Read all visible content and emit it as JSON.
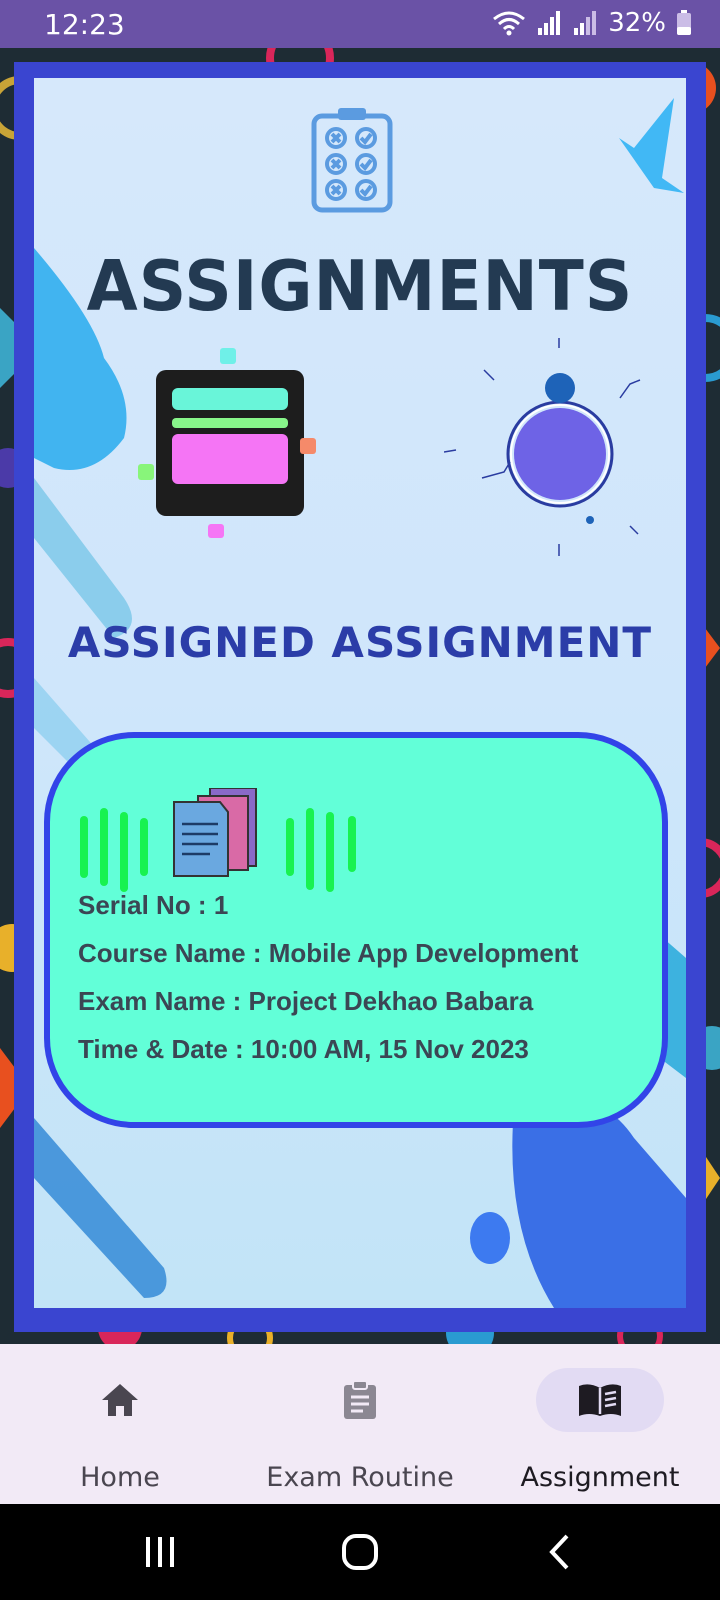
{
  "status_bar": {
    "time": "12:23",
    "battery": "32%"
  },
  "page": {
    "title": "ASSIGNMENTS",
    "section_title": "ASSIGNED ASSIGNMENT"
  },
  "assignment_card": {
    "serial": "Serial No : 1",
    "course": "Course Name : Mobile App Development",
    "exam": "Exam Name : Project Dekhao Babara",
    "datetime": "Time & Date  : 10:00 AM, 15 Nov 2023"
  },
  "bottom_nav": {
    "items": [
      {
        "label": "Home",
        "icon": "home-icon"
      },
      {
        "label": "Exam Routine",
        "icon": "clipboard-icon"
      },
      {
        "label": "Assignment",
        "icon": "book-icon",
        "active": true
      }
    ]
  },
  "colors": {
    "status_bar": "#6a52a6",
    "frame": "#3a45d0",
    "card_fill": "#62ffd8",
    "card_border": "#3244e8",
    "title": "#233a52",
    "section_title": "#2b3da8"
  }
}
